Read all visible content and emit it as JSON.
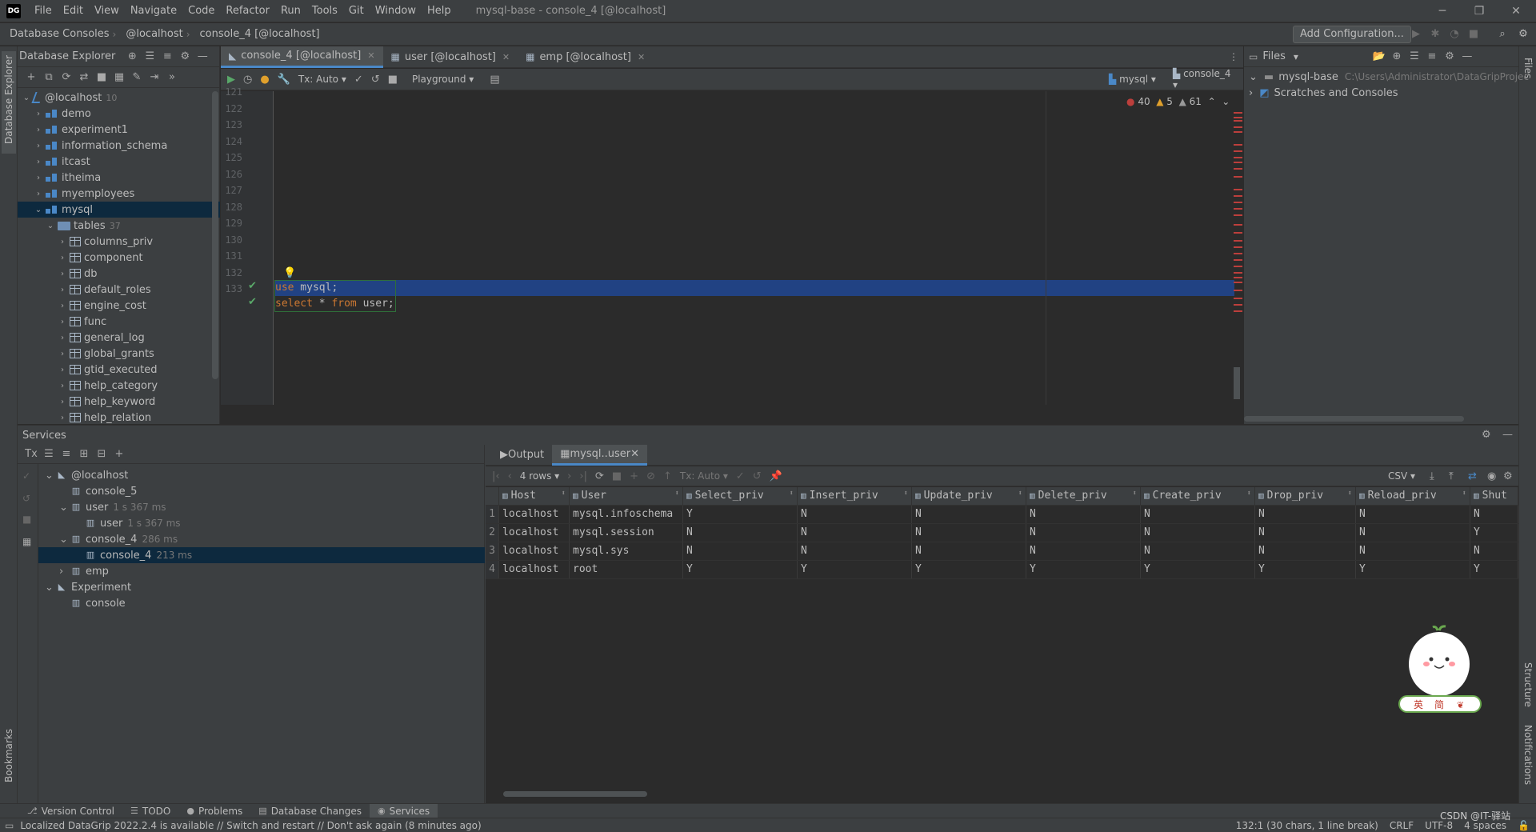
{
  "app": {
    "logo": "DG",
    "menu": [
      "File",
      "Edit",
      "View",
      "Navigate",
      "Code",
      "Refactor",
      "Run",
      "Tools",
      "Git",
      "Window",
      "Help"
    ],
    "window_title": "mysql-base - console_4 [@localhost]"
  },
  "navbar": {
    "crumbs": [
      "Database Consoles",
      "@localhost",
      "console_4 [@localhost]"
    ],
    "add_configuration": "Add Configuration..."
  },
  "left_strip": {
    "database_explorer": "Database Explorer",
    "bookmarks": "Bookmarks"
  },
  "right_strip": {
    "files": "Files",
    "structure": "Structure",
    "notifications": "Notifications"
  },
  "db_explorer": {
    "title": "Database Explorer",
    "tree": [
      {
        "label": "@localhost",
        "count": "10",
        "icon": "host",
        "depth": 0,
        "expanded": true
      },
      {
        "label": "demo",
        "icon": "db",
        "depth": 1
      },
      {
        "label": "experiment1",
        "icon": "db",
        "depth": 1
      },
      {
        "label": "information_schema",
        "icon": "db",
        "depth": 1
      },
      {
        "label": "itcast",
        "icon": "db",
        "depth": 1
      },
      {
        "label": "itheima",
        "icon": "db",
        "depth": 1
      },
      {
        "label": "myemployees",
        "icon": "db",
        "depth": 1
      },
      {
        "label": "mysql",
        "icon": "db",
        "depth": 1,
        "expanded": true,
        "selected": true
      },
      {
        "label": "tables",
        "count": "37",
        "icon": "folder",
        "depth": 2,
        "expanded": true
      },
      {
        "label": "columns_priv",
        "icon": "table",
        "depth": 3
      },
      {
        "label": "component",
        "icon": "table",
        "depth": 3
      },
      {
        "label": "db",
        "icon": "table",
        "depth": 3
      },
      {
        "label": "default_roles",
        "icon": "table",
        "depth": 3
      },
      {
        "label": "engine_cost",
        "icon": "table",
        "depth": 3
      },
      {
        "label": "func",
        "icon": "table",
        "depth": 3
      },
      {
        "label": "general_log",
        "icon": "table",
        "depth": 3
      },
      {
        "label": "global_grants",
        "icon": "table",
        "depth": 3
      },
      {
        "label": "gtid_executed",
        "icon": "table",
        "depth": 3
      },
      {
        "label": "help_category",
        "icon": "table",
        "depth": 3
      },
      {
        "label": "help_keyword",
        "icon": "table",
        "depth": 3
      },
      {
        "label": "help_relation",
        "icon": "table",
        "depth": 3
      }
    ]
  },
  "editor": {
    "tabs": [
      {
        "label": "console_4 [@localhost]",
        "active": true,
        "icon": "console"
      },
      {
        "label": "user [@localhost]",
        "active": false,
        "icon": "table"
      },
      {
        "label": "emp [@localhost]",
        "active": false,
        "icon": "table"
      }
    ],
    "toolbar": {
      "tx": "Tx: Auto",
      "playground": "Playground",
      "schema": "mysql",
      "console": "console_4"
    },
    "line_numbers": [
      "121",
      "122",
      "123",
      "124",
      "125",
      "126",
      "127",
      "128",
      "129",
      "130",
      "131",
      "132",
      "133"
    ],
    "code": [
      {
        "line": "132",
        "keyword": "use",
        "rest": " mysql;"
      },
      {
        "line": "133",
        "keyword": "select",
        "mid": " * ",
        "keyword2": "from",
        "rest": " user;"
      }
    ],
    "inspections": {
      "errors": "40",
      "warnings": "5",
      "weak_warnings": "61"
    }
  },
  "files_panel": {
    "title": "Files",
    "items": [
      {
        "label": "mysql-base",
        "path": "C:\\Users\\Administrator\\DataGripProjec"
      },
      {
        "label": "Scratches and Consoles",
        "path": ""
      }
    ]
  },
  "services": {
    "title": "Services",
    "tree": [
      {
        "label": "@localhost",
        "ms": "",
        "depth": 0,
        "arrow": "v"
      },
      {
        "label": "console_5",
        "ms": "",
        "depth": 1,
        "arrow": ""
      },
      {
        "label": "user",
        "ms": "1 s 367 ms",
        "depth": 1,
        "arrow": "v"
      },
      {
        "label": "user",
        "ms": "1 s 367 ms",
        "depth": 2,
        "arrow": ""
      },
      {
        "label": "console_4",
        "ms": "286 ms",
        "depth": 1,
        "arrow": "v"
      },
      {
        "label": "console_4",
        "ms": "213 ms",
        "depth": 2,
        "arrow": "",
        "selected": true
      },
      {
        "label": "emp",
        "ms": "",
        "depth": 1,
        "arrow": ">"
      },
      {
        "label": "Experiment",
        "ms": "",
        "depth": 0,
        "arrow": "v"
      },
      {
        "label": "console",
        "ms": "",
        "depth": 1,
        "arrow": ""
      }
    ],
    "result_tabs": [
      "Output",
      "mysql..user"
    ],
    "result_toolbar": {
      "rows": "4 rows",
      "tx": "Tx: Auto",
      "export_format": "CSV"
    },
    "columns": [
      "Host",
      "User",
      "Select_priv",
      "Insert_priv",
      "Update_priv",
      "Delete_priv",
      "Create_priv",
      "Drop_priv",
      "Reload_priv",
      "Shut"
    ],
    "rows": [
      [
        "1",
        "localhost",
        "mysql.infoschema",
        "Y",
        "N",
        "N",
        "N",
        "N",
        "N",
        "N",
        "N"
      ],
      [
        "2",
        "localhost",
        "mysql.session",
        "N",
        "N",
        "N",
        "N",
        "N",
        "N",
        "N",
        "Y"
      ],
      [
        "3",
        "localhost",
        "mysql.sys",
        "N",
        "N",
        "N",
        "N",
        "N",
        "N",
        "N",
        "N"
      ],
      [
        "4",
        "localhost",
        "root",
        "Y",
        "Y",
        "Y",
        "Y",
        "Y",
        "Y",
        "Y",
        "Y"
      ]
    ]
  },
  "mascot": {
    "labels": [
      "英",
      "简"
    ]
  },
  "bottom_tools": [
    {
      "label": "Version Control",
      "active": false
    },
    {
      "label": "TODO",
      "active": false
    },
    {
      "label": "Problems",
      "active": false
    },
    {
      "label": "Database Changes",
      "active": false
    },
    {
      "label": "Services",
      "active": true
    }
  ],
  "status": {
    "message": "Localized DataGrip 2022.2.4 is available // Switch and restart // Don't ask again (8 minutes ago)",
    "position": "132:1 (30 chars, 1 line break)",
    "line_sep": "CRLF",
    "encoding": "UTF-8",
    "indent": "4 spaces",
    "watermark": "CSDN @IT-驿站"
  },
  "colors": {
    "accent": "#4a88c7",
    "selection": "#214283",
    "keyword": "#cc7832",
    "ok": "#59a869",
    "error": "#bc3f3c"
  }
}
